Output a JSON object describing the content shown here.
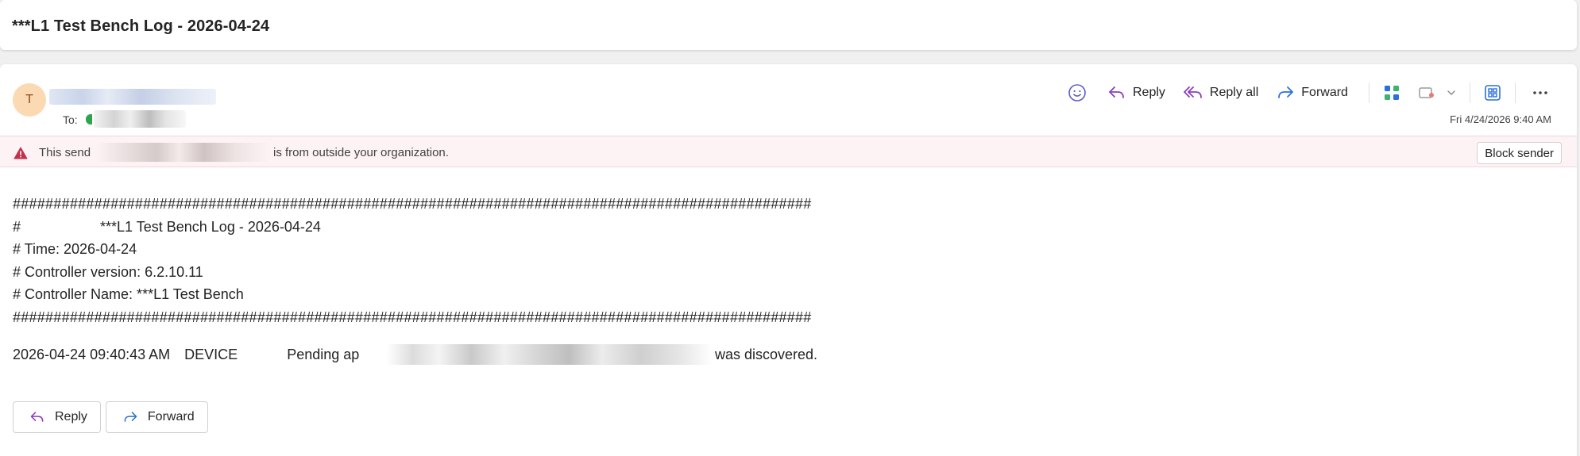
{
  "subject": "***L1 Test Bench Log - 2026-04-24",
  "sender": {
    "avatar_initial": "T"
  },
  "recipients": {
    "to_label": "To:"
  },
  "toolbar": {
    "reply_label": "Reply",
    "reply_all_label": "Reply all",
    "forward_label": "Forward"
  },
  "date": "Fri 4/24/2026 9:40 AM",
  "banner": {
    "prefix": "This send",
    "suffix": "is from outside your organization.",
    "block_label": "Block sender"
  },
  "body": {
    "hash_line": "##################################################################################################",
    "header_title_line": "#                    ***L1 Test Bench Log - 2026-04-24",
    "time_line": "# Time: 2026-04-24",
    "version_line": "# Controller version: 6.2.10.11",
    "name_line": "# Controller Name: ***L1 Test Bench",
    "log_entry": {
      "timestamp": "2026-04-24 09:40:43 AM",
      "category": "DEVICE",
      "message_start": "Pending ap",
      "message_end": "was discovered."
    }
  },
  "actions": {
    "reply_label": "Reply",
    "forward_label": "Forward"
  },
  "colors": {
    "accent": "#5b5fc7",
    "reply_icon": "#8a3fb5",
    "forward_icon": "#2a6fdb",
    "warning": "#c4314b",
    "avatar_bg": "#fbd9b3"
  }
}
